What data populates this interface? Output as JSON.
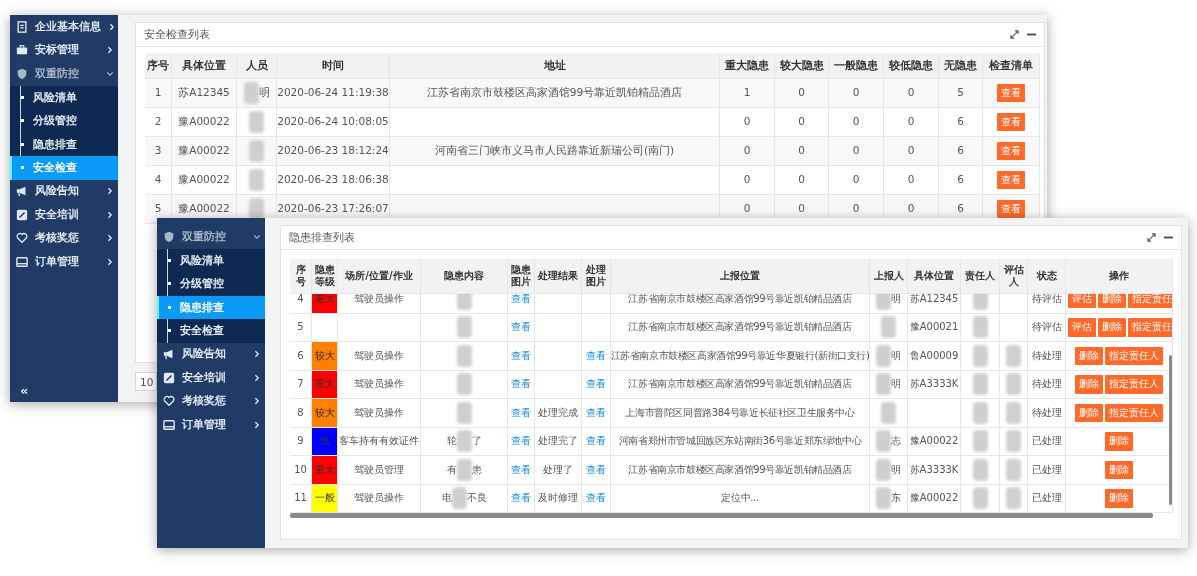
{
  "back_window": {
    "sidebar": {
      "items": [
        {
          "label": "企业基本信息",
          "kind": "document",
          "expanded": false
        },
        {
          "label": "安标管理",
          "kind": "briefcase",
          "expanded": false
        },
        {
          "label": "双重防控",
          "kind": "shield",
          "expanded": true,
          "children": [
            {
              "label": "风险清单",
              "selected": false
            },
            {
              "label": "分级管控",
              "selected": false
            },
            {
              "label": "隐患排查",
              "selected": false
            },
            {
              "label": "安全检查",
              "selected": true
            }
          ]
        },
        {
          "label": "风险告知",
          "kind": "megaphone",
          "expanded": false
        },
        {
          "label": "安全培训",
          "kind": "edit",
          "expanded": false
        },
        {
          "label": "考核奖惩",
          "kind": "heart",
          "expanded": false
        },
        {
          "label": "订单管理",
          "kind": "card",
          "expanded": false
        }
      ],
      "collapse": "«"
    },
    "panel": {
      "title": "安全检查列表"
    },
    "table": {
      "columns": [
        "序号",
        "具体位置",
        "人员",
        "时间",
        "地址",
        "重大隐患",
        "较大隐患",
        "一般隐患",
        "较低隐患",
        "无隐患",
        "检查清单"
      ],
      "rows": [
        {
          "cells": [
            "1",
            "苏A12345",
            {
              "kind": "redacted",
              "after": "明"
            },
            "2020-06-24 11:19:38",
            "江苏省南京市鼓楼区高家酒馆99号靠近凯铂精品酒店",
            "1",
            "0",
            "0",
            "0",
            "5",
            {
              "kind": "button",
              "label": "查看"
            }
          ]
        },
        {
          "cells": [
            "2",
            "豫A00022",
            {
              "kind": "redacted"
            },
            "2020-06-24 10:08:05",
            null,
            "0",
            "0",
            "0",
            "0",
            "6",
            {
              "kind": "button",
              "label": "查看"
            }
          ]
        },
        {
          "cells": [
            "3",
            "豫A00022",
            {
              "kind": "redacted"
            },
            "2020-06-23 18:12:24",
            "河南省三门峡市义马市人民路靠近新瑞公司(南门)",
            "0",
            "0",
            "0",
            "0",
            "6",
            {
              "kind": "button",
              "label": "查看"
            }
          ]
        },
        {
          "cells": [
            "4",
            "豫A00022",
            {
              "kind": "redacted"
            },
            "2020-06-23 18:06:38",
            null,
            "0",
            "0",
            "0",
            "0",
            "6",
            {
              "kind": "button",
              "label": "查看"
            }
          ]
        },
        {
          "cells": [
            "5",
            "豫A00022",
            {
              "kind": "redacted"
            },
            "2020-06-23 17:26:07",
            null,
            "0",
            "0",
            "0",
            "0",
            "6",
            {
              "kind": "button",
              "label": "查看"
            }
          ]
        }
      ]
    },
    "pagination": {
      "page_size": "10"
    }
  },
  "front_window": {
    "sidebar": {
      "items": [
        {
          "label": "双重防控",
          "kind": "shield",
          "expanded": true,
          "children": [
            {
              "label": "风险清单",
              "selected": false
            },
            {
              "label": "分级管控",
              "selected": false
            },
            {
              "label": "隐患排查",
              "selected": true
            },
            {
              "label": "安全检查",
              "selected": false
            }
          ]
        },
        {
          "label": "风险告知",
          "kind": "megaphone",
          "expanded": false
        },
        {
          "label": "安全培训",
          "kind": "edit",
          "expanded": false
        },
        {
          "label": "考核奖惩",
          "kind": "heart",
          "expanded": false
        },
        {
          "label": "订单管理",
          "kind": "card",
          "expanded": false
        }
      ]
    },
    "panel": {
      "title": "隐患排查列表"
    },
    "table": {
      "columns": [
        "序号",
        "隐患等级",
        "场所/位置/作业",
        "隐患内容",
        "隐患图片",
        "处理结果",
        "处理图片",
        "上报位置",
        "上报人",
        "具体位置",
        "责任人",
        "评估人",
        "状态",
        "操作"
      ],
      "rows": [
        {
          "cells": [
            "4",
            {
              "kind": "level",
              "label": "重大",
              "color": "#ff0000"
            },
            "驾驶员操作",
            {
              "kind": "redacted"
            },
            {
              "kind": "link",
              "label": "查看"
            },
            null,
            null,
            "江苏省南京市鼓楼区高家酒馆99号靠近凯铂精品酒店",
            {
              "kind": "redacted",
              "after": "明"
            },
            "苏A12345",
            {
              "kind": "redacted"
            },
            null,
            "待评估",
            {
              "kind": "actions",
              "buttons": [
                "评估",
                "删除",
                "指定责任"
              ]
            }
          ]
        },
        {
          "cells": [
            "5",
            null,
            null,
            {
              "kind": "redacted"
            },
            {
              "kind": "link",
              "label": "查看"
            },
            null,
            null,
            "江苏省南京市鼓楼区高家酒馆99号靠近凯铂精品酒店",
            {
              "kind": "redacted"
            },
            "豫A00021",
            {
              "kind": "redacted"
            },
            null,
            "待评估",
            {
              "kind": "actions",
              "buttons": [
                "评估",
                "删除",
                "指定责任"
              ]
            }
          ]
        },
        {
          "cells": [
            "6",
            {
              "kind": "level",
              "label": "较大",
              "color": "#ff7f00"
            },
            "驾驶员操作",
            {
              "kind": "redacted"
            },
            {
              "kind": "link",
              "label": "查看"
            },
            null,
            {
              "kind": "link",
              "label": "查看"
            },
            "江苏省南京市鼓楼区高家酒馆99号靠近华夏银行(新街口支行)",
            {
              "kind": "redacted",
              "after": "明"
            },
            "鲁A00009",
            {
              "kind": "redacted"
            },
            {
              "kind": "redacted"
            },
            "待处理",
            {
              "kind": "actions",
              "buttons": [
                "删除",
                "指定责任人"
              ]
            }
          ]
        },
        {
          "cells": [
            "7",
            {
              "kind": "level",
              "label": "重大",
              "color": "#ff0000"
            },
            "驾驶员操作",
            {
              "kind": "redacted"
            },
            {
              "kind": "link",
              "label": "查看"
            },
            null,
            {
              "kind": "link",
              "label": "查看"
            },
            "江苏省南京市鼓楼区高家酒馆99号靠近凯铂精品酒店",
            {
              "kind": "redacted",
              "after": "明"
            },
            "苏A3333K",
            {
              "kind": "redacted"
            },
            {
              "kind": "redacted"
            },
            "待处理",
            {
              "kind": "actions",
              "buttons": [
                "删除",
                "指定责任人"
              ]
            }
          ]
        },
        {
          "cells": [
            "8",
            {
              "kind": "level",
              "label": "较大",
              "color": "#ff7f00"
            },
            "驾驶员操作",
            {
              "kind": "redacted"
            },
            {
              "kind": "link",
              "label": "查看"
            },
            "处理完成",
            {
              "kind": "link",
              "label": "查看"
            },
            "上海市普陀区同普路384号靠近长征社区卫生服务中心",
            {
              "kind": "redacted"
            },
            null,
            {
              "kind": "redacted"
            },
            {
              "kind": "redacted"
            },
            "待处理",
            {
              "kind": "actions",
              "buttons": [
                "删除",
                "指定责任人"
              ]
            }
          ]
        },
        {
          "cells": [
            "9",
            {
              "kind": "level",
              "label": "低",
              "color": "#0000ff"
            },
            "客车持有有效证件",
            {
              "kind": "redacted",
              "before": "轮",
              "after": "了"
            },
            {
              "kind": "link",
              "label": "查看"
            },
            "处理完了",
            {
              "kind": "link",
              "label": "查看"
            },
            "河南省郑州市管城回族区东站南街36号靠近郑东绿地中心",
            {
              "kind": "redacted",
              "after": "志"
            },
            "豫A00022",
            {
              "kind": "redacted"
            },
            {
              "kind": "redacted"
            },
            "已处理",
            {
              "kind": "actions",
              "buttons": [
                "删除"
              ]
            }
          ]
        },
        {
          "cells": [
            "10",
            {
              "kind": "level",
              "label": "重大",
              "color": "#ff0000"
            },
            "驾驶员管理",
            {
              "kind": "redacted",
              "before": "有",
              "after": "患"
            },
            {
              "kind": "link",
              "label": "查看"
            },
            "处理了",
            {
              "kind": "link",
              "label": "查看"
            },
            "江苏省南京市鼓楼区高家酒馆99号靠近凯铂精品酒店",
            {
              "kind": "redacted",
              "after": "明"
            },
            "苏A3333K",
            {
              "kind": "redacted"
            },
            {
              "kind": "redacted"
            },
            "已处理",
            {
              "kind": "actions",
              "buttons": [
                "删除"
              ]
            }
          ]
        },
        {
          "cells": [
            "11",
            {
              "kind": "level",
              "label": "一般",
              "color": "#ffff00"
            },
            "驾驶员操作",
            {
              "kind": "redacted",
              "before": "电",
              "after": "不良"
            },
            {
              "kind": "link",
              "label": "查看"
            },
            "及时修理",
            {
              "kind": "link",
              "label": "查看"
            },
            "定位中...",
            {
              "kind": "redacted",
              "after": "东"
            },
            "豫A00022",
            {
              "kind": "redacted"
            },
            {
              "kind": "redacted"
            },
            "已处理",
            {
              "kind": "actions",
              "buttons": [
                "删除"
              ]
            }
          ]
        }
      ]
    }
  }
}
